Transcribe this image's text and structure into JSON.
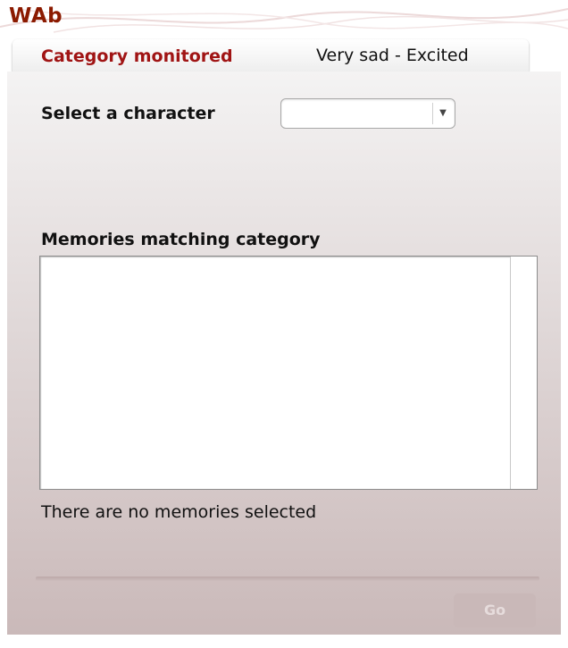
{
  "app": {
    "title": "WAb"
  },
  "header": {
    "category_label": "Category monitored",
    "category_value": "Very sad - Excited"
  },
  "character_select": {
    "label": "Select a character",
    "value": "",
    "arrow": "▼"
  },
  "memories": {
    "label": "Memories matching category",
    "items": [],
    "status": "There are no memories selected"
  },
  "actions": {
    "go_label": "Go",
    "go_enabled": false
  },
  "colors": {
    "brand": "#8b1a00",
    "category_label": "#a01414",
    "panel_top": "#f4f3f3",
    "panel_bottom": "#cab9b9",
    "disabled_button_text": "#e6dcdc"
  }
}
